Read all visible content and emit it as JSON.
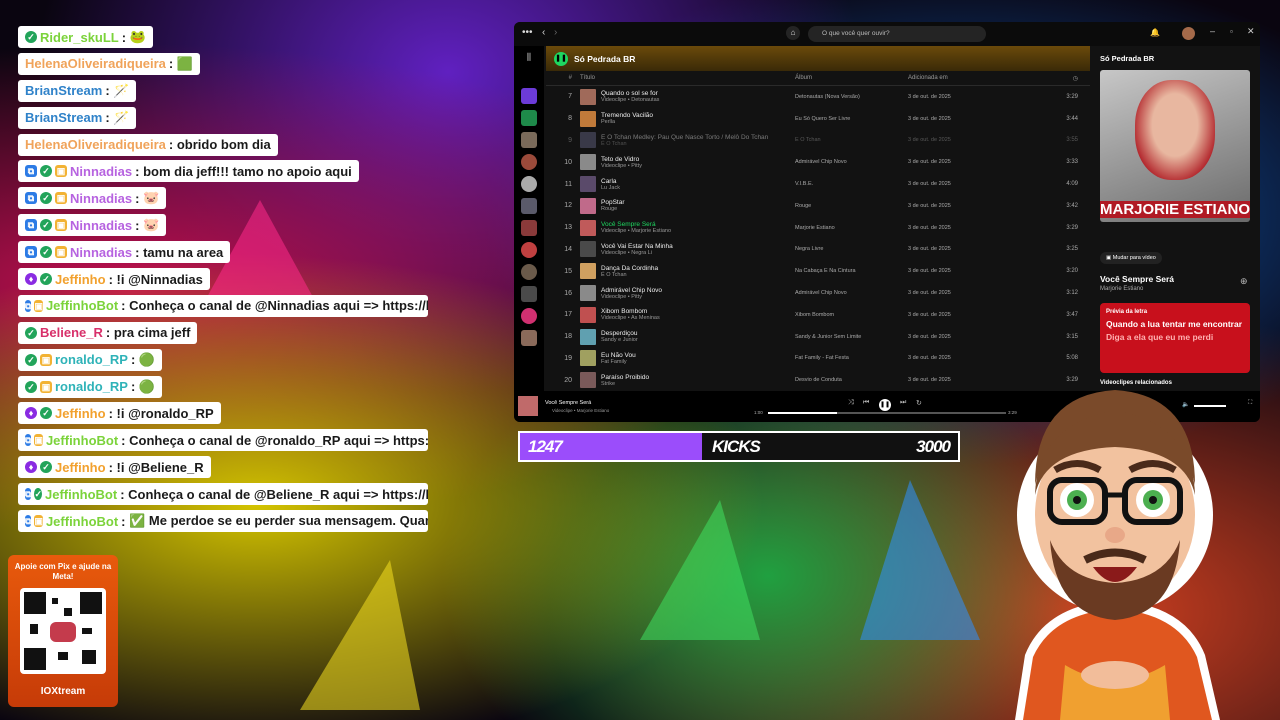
{
  "chat": {
    "messages": [
      {
        "user": "Rider_skuLL",
        "color": "#7bd33a",
        "text": "",
        "badges": [
          "ok"
        ],
        "sep": ": ",
        "emote": "🐸"
      },
      {
        "user": "HelenaOliveiradiqueira",
        "color": "#f0a35a",
        "text": "",
        "badges": [],
        "sep": ": ",
        "emote": "🟩"
      },
      {
        "user": "BrianStream",
        "color": "#2f82c9",
        "text": "",
        "badges": [],
        "sep": ": ",
        "emote": "🪄"
      },
      {
        "user": "BrianStream",
        "color": "#2f82c9",
        "text": "",
        "badges": [],
        "sep": ": ",
        "emote": "🪄"
      },
      {
        "user": "HelenaOliveiradiqueira",
        "color": "#f0a35a",
        "text": "obrido bom dia",
        "badges": [],
        "sep": ": ",
        "emote": ""
      },
      {
        "user": "Ninnadias",
        "color": "#b763e0",
        "text": "bom dia jeff!!! tamo no apoio aqui",
        "badges": [
          "mod",
          "ok",
          "gift"
        ],
        "sep": ": ",
        "emote": ""
      },
      {
        "user": "Ninnadias",
        "color": "#b763e0",
        "text": "",
        "badges": [
          "mod",
          "ok",
          "gift"
        ],
        "sep": ": ",
        "emote": "🐷"
      },
      {
        "user": "Ninnadias",
        "color": "#b763e0",
        "text": "",
        "badges": [
          "mod",
          "ok",
          "gift"
        ],
        "sep": ": ",
        "emote": "🐷"
      },
      {
        "user": "Ninnadias",
        "color": "#b763e0",
        "text": "tamu na area",
        "badges": [
          "mod",
          "ok",
          "gift"
        ],
        "sep": ": ",
        "emote": ""
      },
      {
        "user": "Jeffinho",
        "color": "#f2a12e",
        "text": "!i @Ninnadias",
        "badges": [
          "gem",
          "ok"
        ],
        "sep": ": ",
        "emote": ""
      },
      {
        "user": "JeffinhoBot",
        "color": "#7bd33a",
        "text": "Conheça o canal de @Ninnadias aqui => https://kick.",
        "badges": [
          "mod",
          "gift"
        ],
        "sep": ": ",
        "emote": ""
      },
      {
        "user": "Beliene_R",
        "color": "#d8306a",
        "text": "pra cima jeff",
        "badges": [
          "ok"
        ],
        "sep": ": ",
        "emote": ""
      },
      {
        "user": "ronaldo_RP",
        "color": "#2fb3b8",
        "text": "",
        "badges": [
          "ok",
          "gift"
        ],
        "sep": ": ",
        "emote": "🟢"
      },
      {
        "user": "ronaldo_RP",
        "color": "#2fb3b8",
        "text": "",
        "badges": [
          "ok",
          "gift"
        ],
        "sep": ": ",
        "emote": "🟢"
      },
      {
        "user": "Jeffinho",
        "color": "#f2a12e",
        "text": "!i @ronaldo_RP",
        "badges": [
          "gem",
          "ok"
        ],
        "sep": ": ",
        "emote": ""
      },
      {
        "user": "JeffinhoBot",
        "color": "#7bd33a",
        "text": "Conheça o canal de @ronaldo_RP aqui => https://kic",
        "badges": [
          "mod",
          "gift"
        ],
        "sep": ": ",
        "emote": ""
      },
      {
        "user": "Jeffinho",
        "color": "#f2a12e",
        "text": "!i @Beliene_R",
        "badges": [
          "gem",
          "ok"
        ],
        "sep": ": ",
        "emote": ""
      },
      {
        "user": "JeffinhoBot",
        "color": "#7bd33a",
        "text": "Conheça o canal de @Beliene_R aqui => https://kick.",
        "badges": [
          "mod",
          "ok"
        ],
        "sep": ": ",
        "emote": ""
      },
      {
        "user": "JeffinhoBot",
        "color": "#7bd33a",
        "text": "✅ Me perdoe se eu perder sua mensagem. Quando",
        "badges": [
          "mod",
          "gift"
        ],
        "sep": ": ",
        "emote": ""
      }
    ]
  },
  "pix": {
    "text": "Apoie com Pix e ajude na Meta!",
    "brand": "IOXtream"
  },
  "spotify": {
    "search_placeholder": "O que você quer ouvir?",
    "playlist_title": "Só Pedrada BR",
    "columns": {
      "num": "#",
      "title": "Título",
      "album": "Álbum",
      "added": "Adicionada em"
    },
    "tracks": [
      {
        "n": "7",
        "title": "Quando o sol se for",
        "artist": "Videoclipe • Detonautas",
        "album": "Detonautas (Nova Versão)",
        "date": "3 de out. de 2025",
        "dur": "3:29",
        "state": ""
      },
      {
        "n": "8",
        "title": "Tremendo Vacilão",
        "artist": "Perlla",
        "album": "Eu Só Quero Ser Livre",
        "date": "3 de out. de 2025",
        "dur": "3:44",
        "state": ""
      },
      {
        "n": "9",
        "title": "É O Tchan Medley: Pau Que Nasce Torto / Melô Do Tchan",
        "artist": "É O Tchan",
        "album": "É O Tchan",
        "date": "3 de out. de 2025",
        "dur": "3:55",
        "state": "dim"
      },
      {
        "n": "10",
        "title": "Teto de Vidro",
        "artist": "Videoclipe • Pitty",
        "album": "Admirável Chip Novo",
        "date": "3 de out. de 2025",
        "dur": "3:33",
        "state": ""
      },
      {
        "n": "11",
        "title": "Carla",
        "artist": "Lu Jack",
        "album": "V.I.B.E.",
        "date": "3 de out. de 2025",
        "dur": "4:09",
        "state": ""
      },
      {
        "n": "12",
        "title": "PopStar",
        "artist": "Rouge",
        "album": "Rouge",
        "date": "3 de out. de 2025",
        "dur": "3:42",
        "state": ""
      },
      {
        "n": "13",
        "title": "Você Sempre Será",
        "artist": "Videoclipe • Marjorie Estiano",
        "album": "Marjorie Estiano",
        "date": "3 de out. de 2025",
        "dur": "3:29",
        "state": "active"
      },
      {
        "n": "14",
        "title": "Você Vai Estar Na Minha",
        "artist": "Videoclipe • Negra Li",
        "album": "Negra Livre",
        "date": "3 de out. de 2025",
        "dur": "3:25",
        "state": ""
      },
      {
        "n": "15",
        "title": "Dança Da Cordinha",
        "artist": "É O Tchan",
        "album": "Na Cabaça E Na Cintura",
        "date": "3 de out. de 2025",
        "dur": "3:20",
        "state": ""
      },
      {
        "n": "16",
        "title": "Admirável Chip Novo",
        "artist": "Videoclipe • Pitty",
        "album": "Admirável Chip Novo",
        "date": "3 de out. de 2025",
        "dur": "3:12",
        "state": ""
      },
      {
        "n": "17",
        "title": "Xibom Bombom",
        "artist": "Videoclipe • As Meninas",
        "album": "Xibom Bombom",
        "date": "3 de out. de 2025",
        "dur": "3:47",
        "state": ""
      },
      {
        "n": "18",
        "title": "Desperdiçou",
        "artist": "Sandy e Junior",
        "album": "Sandy & Junior Sem Limite",
        "date": "3 de out. de 2025",
        "dur": "3:15",
        "state": ""
      },
      {
        "n": "19",
        "title": "Eu Não Vou",
        "artist": "Fat Family",
        "album": "Fat Family - Fat Festa",
        "date": "3 de out. de 2025",
        "dur": "5:08",
        "state": ""
      },
      {
        "n": "20",
        "title": "Paraíso Proibido",
        "artist": "Strike",
        "album": "Desvio de Conduta",
        "date": "3 de out. de 2025",
        "dur": "3:29",
        "state": ""
      }
    ],
    "right_title": "Só Pedrada BR",
    "cover_name": "MARJORIE ESTIANO",
    "video_btn": "Mudar para vídeo",
    "now_song": "Você Sempre Será",
    "now_artist": "Marjorie Estiano",
    "lyrics_head": "Prévia da letra",
    "lyrics_line1": "Quando a lua tentar me encontrar",
    "lyrics_line2": "Diga a ela que eu me perdi",
    "related": "Videoclipes relacionados",
    "player_song": "Você Sempre Será",
    "player_artist": "Videoclipe • Marjorie Estiano",
    "time_elapsed": "1:00",
    "time_total": "3:29",
    "progress": 0.29
  },
  "kicks": {
    "current": "1247",
    "label": "KICKS",
    "goal": "3000",
    "fraction": 0.4157
  }
}
